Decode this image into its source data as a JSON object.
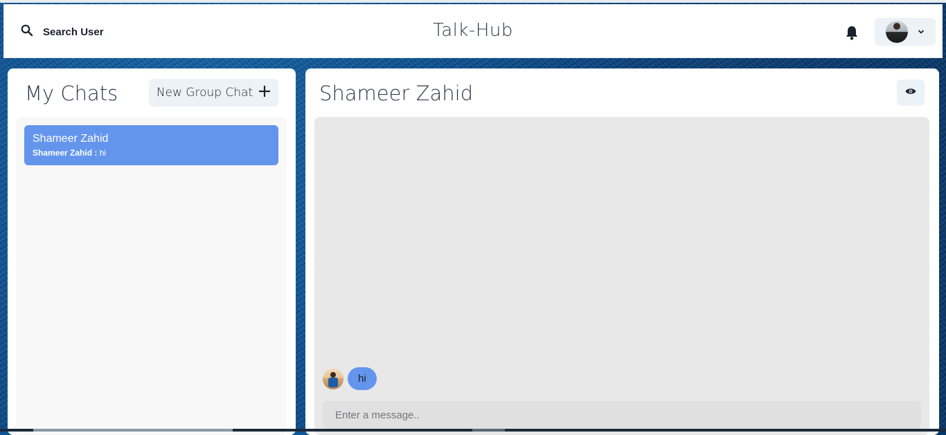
{
  "header": {
    "search_label": "Search User",
    "brand": "Talk-Hub"
  },
  "sidebar": {
    "title": "My Chats",
    "new_group_label": "New Group Chat",
    "chats": [
      {
        "name": "Shameer Zahid",
        "last_sender": "Shameer Zahid :",
        "last_message": "hi",
        "selected": true
      }
    ]
  },
  "conversation": {
    "title": "Shameer Zahid",
    "messages": [
      {
        "text": "hi",
        "from_other": true
      }
    ],
    "input_placeholder": "Enter a message.."
  },
  "icons": {
    "search": "search-icon",
    "bell": "bell-icon",
    "chevron": "chevron-down-icon",
    "plus": "plus-icon",
    "eye": "eye-icon"
  },
  "colors": {
    "accent": "#6495ed",
    "button_bg": "#edf2f7",
    "chat_bg": "#e8e8e8"
  }
}
